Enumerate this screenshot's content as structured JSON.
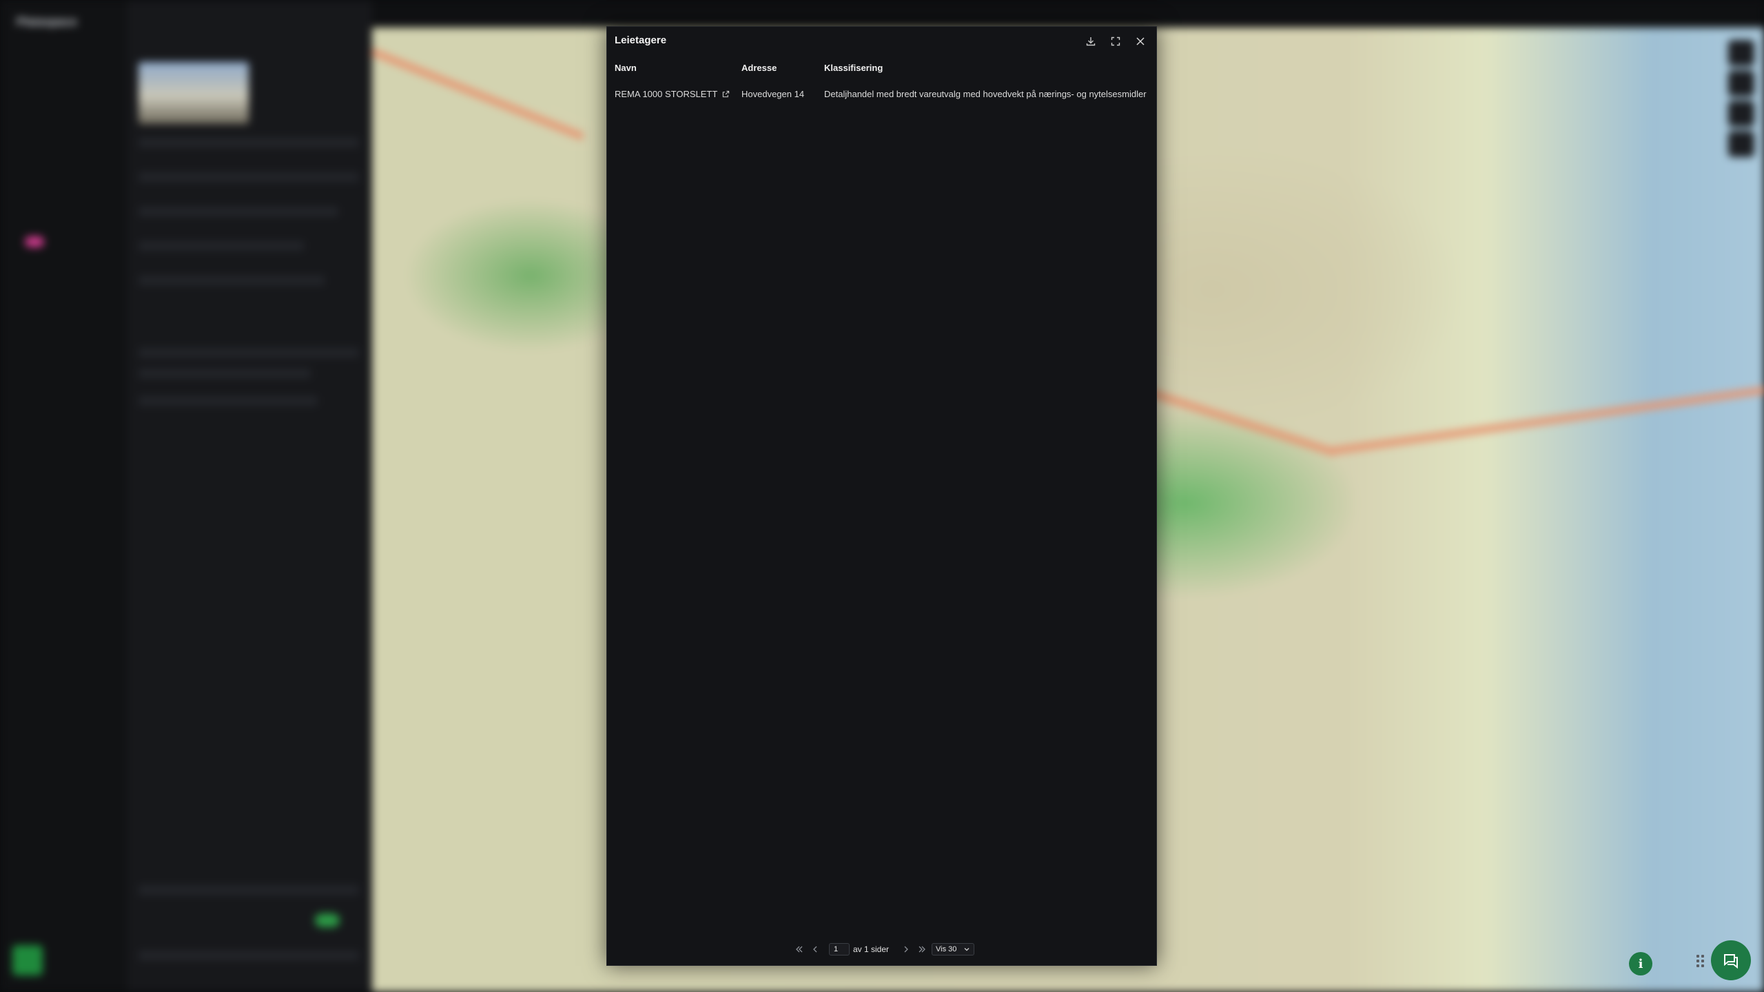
{
  "app": {
    "name": "Plaiaspace"
  },
  "modal": {
    "title": "Leietagere",
    "columns": [
      "Navn",
      "Adresse",
      "Klassifisering"
    ],
    "rows": [
      {
        "navn": "REMA 1000 STORSLETT",
        "adresse": "Hovedvegen 14",
        "klassifisering": "Detaljhandel med bredt vareutvalg med hovedvekt på nærings- og nytelsesmidler"
      }
    ],
    "pagination": {
      "current_page": "1",
      "of_pages_text": "av 1 sider",
      "per_page": "Vis 30"
    }
  },
  "icons": {
    "download": "download-icon",
    "expand": "expand-icon",
    "close": "close-icon",
    "external_link": "external-link-icon",
    "first_page": "first-page-icon",
    "prev_page": "prev-page-icon",
    "next_page": "next-page-icon",
    "last_page": "last-page-icon",
    "info": "info-icon",
    "chat": "chat-icon"
  },
  "colors": {
    "modal_bg": "#131417",
    "accent_green": "#1e7a45"
  }
}
